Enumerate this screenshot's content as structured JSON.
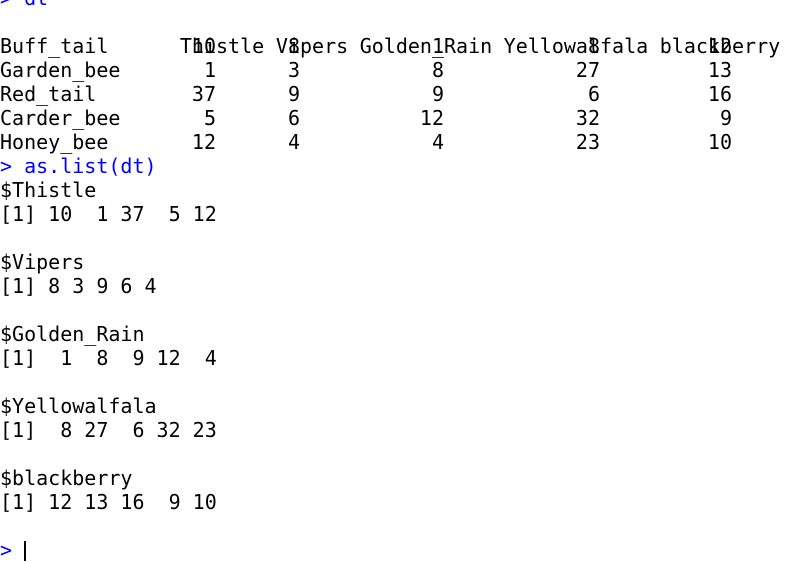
{
  "console": {
    "prompt": ">",
    "cmd1": "dt",
    "cmd2": "as.list(dt)",
    "table": {
      "headers": [
        "Thistle",
        "Vipers",
        "Golden_Rain",
        "Yellowalfala",
        "blackberry"
      ],
      "rows": [
        {
          "name": "Buff_tail",
          "values": [
            "10",
            "8",
            "1",
            "8",
            "12"
          ]
        },
        {
          "name": "Garden_bee",
          "values": [
            "1",
            "3",
            "8",
            "27",
            "13"
          ]
        },
        {
          "name": "Red_tail",
          "values": [
            "37",
            "9",
            "9",
            "6",
            "16"
          ]
        },
        {
          "name": "Carder_bee",
          "values": [
            "5",
            "6",
            "12",
            "32",
            "9"
          ]
        },
        {
          "name": "Honey_bee",
          "values": [
            "12",
            "4",
            "4",
            "23",
            "10"
          ]
        }
      ]
    },
    "list": [
      {
        "name": "$Thistle",
        "values": "[1] 10  1 37  5 12"
      },
      {
        "name": "$Vipers",
        "values": "[1] 8 3 9 6 4"
      },
      {
        "name": "$Golden_Rain",
        "values": "[1]  1  8  9 12  4"
      },
      {
        "name": "$Yellowalfala",
        "values": "[1]  8 27  6 32 23"
      },
      {
        "name": "$blackberry",
        "values": "[1] 12 13 16  9 10"
      }
    ]
  }
}
